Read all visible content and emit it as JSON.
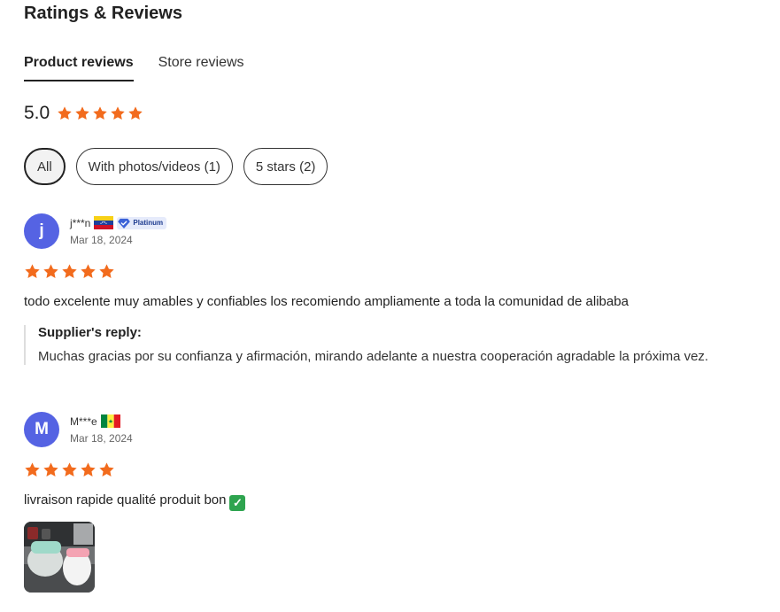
{
  "page": {
    "title": "Ratings & Reviews"
  },
  "tabs": [
    {
      "label": "Product reviews",
      "active": true
    },
    {
      "label": "Store reviews",
      "active": false
    }
  ],
  "overall": {
    "score": "5.0",
    "stars": 5
  },
  "filters": [
    {
      "label": "All",
      "active": true
    },
    {
      "label": "With photos/videos (1)",
      "active": false
    },
    {
      "label": "5 stars (2)",
      "active": false
    }
  ],
  "colors": {
    "star": "#f26b1d",
    "avatar": "#5563e3",
    "badge_bg": "#e6ebfb",
    "badge_text": "#1d3b8f",
    "check": "#2ea44f"
  },
  "reviews": [
    {
      "initial": "j",
      "name": "j***n",
      "flag": "venezuela-flag-icon",
      "badge": "Platinum",
      "date": "Mar 18, 2024",
      "stars": 5,
      "text": "todo excelente muy amables y confiables los recomiendo ampliamente a toda la comunidad de alibaba",
      "reply_title": "Supplier's reply:",
      "reply_text": "Muchas gracias por su confianza y afirmación, mirando adelante a nuestra cooperación agradable la próxima vez."
    },
    {
      "initial": "M",
      "name": "M***e",
      "flag": "senegal-flag-icon",
      "date": "Mar 18, 2024",
      "stars": 5,
      "text": "livraison rapide qualité produit bon",
      "emoji": "check-mark-icon",
      "photo": "review-photo"
    }
  ]
}
